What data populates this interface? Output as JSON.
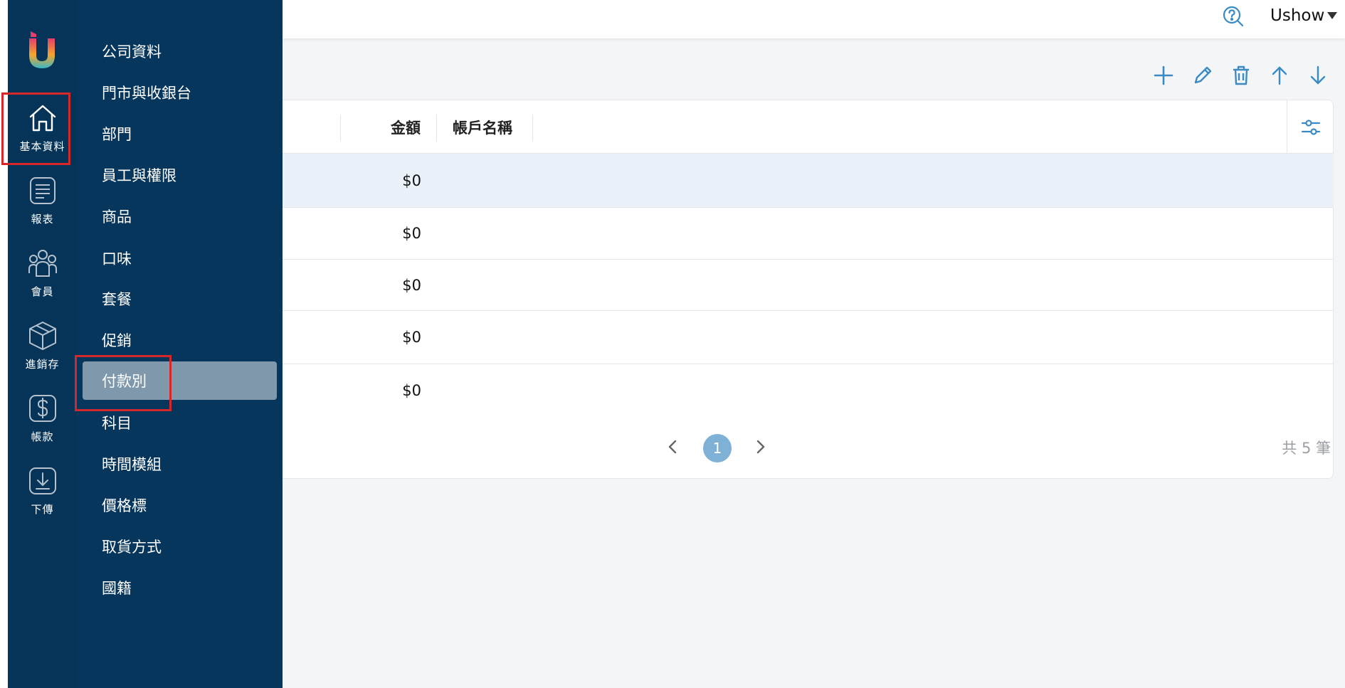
{
  "brand": {
    "logo_icon": "u-logo-icon",
    "colors": {
      "rail_bg": "#063458",
      "submenu_bg": "#07365c",
      "active_item": "#7f98ab",
      "accent_blue": "#3a8ac4",
      "highlight_red": "#d6272b"
    }
  },
  "rail": {
    "items": [
      {
        "label": "基本資料",
        "icon": "home-icon"
      },
      {
        "label": "報表",
        "icon": "report-icon"
      },
      {
        "label": "會員",
        "icon": "members-icon"
      },
      {
        "label": "進銷存",
        "icon": "box-icon"
      },
      {
        "label": "帳款",
        "icon": "dollar-icon"
      },
      {
        "label": "下傳",
        "icon": "download-icon"
      }
    ]
  },
  "submenu": {
    "items": [
      {
        "label": "公司資料"
      },
      {
        "label": "門市與收銀台"
      },
      {
        "label": "部門"
      },
      {
        "label": "員工與權限"
      },
      {
        "label": "商品"
      },
      {
        "label": "口味"
      },
      {
        "label": "套餐"
      },
      {
        "label": "促銷"
      },
      {
        "label": "付款別"
      },
      {
        "label": "科目"
      },
      {
        "label": "時間模組"
      },
      {
        "label": "價格標"
      },
      {
        "label": "取貨方式"
      },
      {
        "label": "國籍"
      }
    ],
    "active_label": "付款別"
  },
  "header": {
    "help_icon": "help-search-icon",
    "user": "Ushow"
  },
  "toolbar": {
    "buttons": [
      "add-icon",
      "edit-icon",
      "delete-icon",
      "move-up-icon",
      "move-down-icon"
    ]
  },
  "table": {
    "columns": [
      "金額",
      "帳戶名稱"
    ],
    "rows": [
      {
        "amount": "$0",
        "account_name": ""
      },
      {
        "amount": "$0",
        "account_name": ""
      },
      {
        "amount": "$0",
        "account_name": ""
      },
      {
        "amount": "$0",
        "account_name": ""
      },
      {
        "amount": "$0",
        "account_name": ""
      }
    ]
  },
  "pagination": {
    "current_page": "1",
    "total": "共 5 筆"
  }
}
